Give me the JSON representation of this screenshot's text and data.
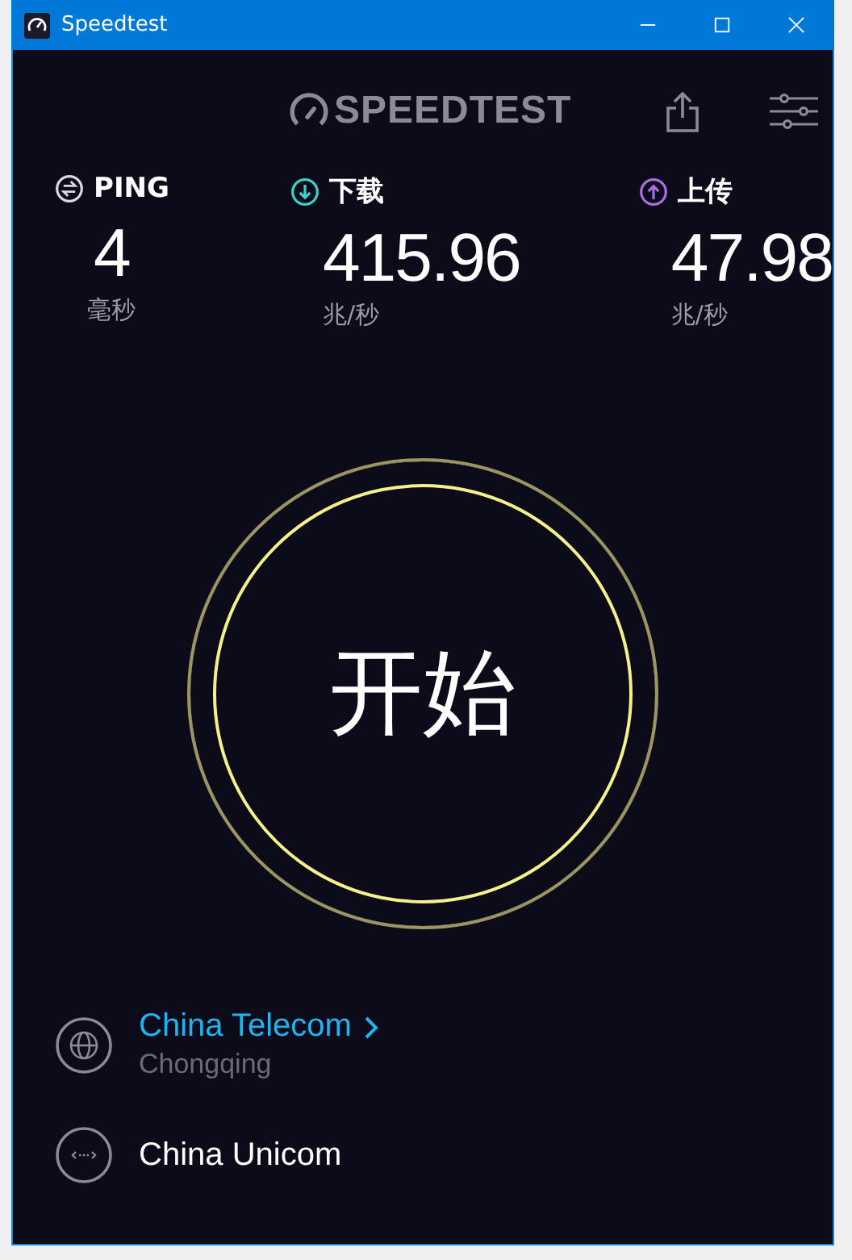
{
  "window": {
    "title": "Speedtest"
  },
  "logo": {
    "text": "SPEEDTEST"
  },
  "metrics": [
    {
      "kind": "ping",
      "label": "PING",
      "value": "4",
      "unit": "毫秒",
      "color": "#d8d8e0"
    },
    {
      "kind": "download",
      "label": "下载",
      "value": "415.96",
      "unit": "兆/秒",
      "color": "#3ccfc8"
    },
    {
      "kind": "upload",
      "label": "上传",
      "value": "47.98",
      "unit": "兆/秒",
      "color": "#a66ee0"
    }
  ],
  "start_button": {
    "label": "开始"
  },
  "servers": [
    {
      "kind": "globe",
      "name": "China Telecom",
      "location": "Chongqing",
      "selected": true
    },
    {
      "kind": "link",
      "name": "China Unicom",
      "selected": false
    }
  ]
}
